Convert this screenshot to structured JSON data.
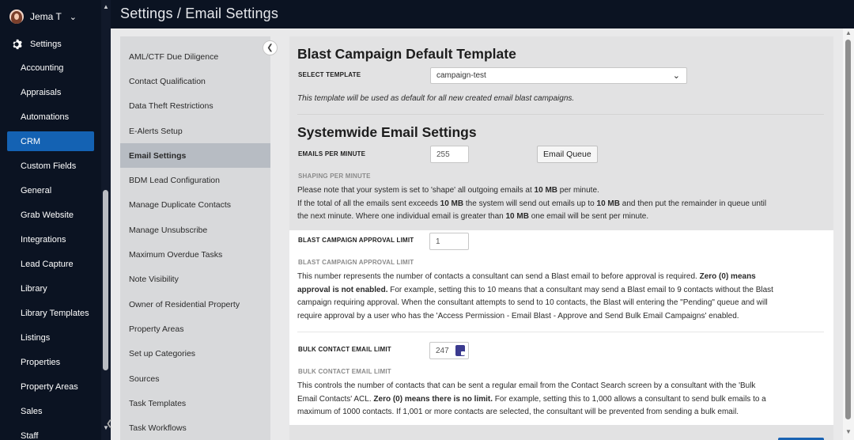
{
  "user": {
    "name": "Jema T"
  },
  "header": {
    "title": "Settings / Email Settings"
  },
  "nav": {
    "section": "Settings",
    "items": [
      "Accounting",
      "Appraisals",
      "Automations",
      "CRM",
      "Custom Fields",
      "General",
      "Grab Website",
      "Integrations",
      "Lead Capture",
      "Library",
      "Library Templates",
      "Listings",
      "Properties",
      "Property Areas",
      "Sales",
      "Staff"
    ],
    "active": "CRM"
  },
  "subnav": {
    "items": [
      "AML/CTF Due Diligence",
      "Contact Qualification",
      "Data Theft Restrictions",
      "E-Alerts Setup",
      "Email Settings",
      "BDM Lead Configuration",
      "Manage Duplicate Contacts",
      "Manage Unsubscribe",
      "Maximum Overdue Tasks",
      "Note Visibility",
      "Owner of Residential Property",
      "Property Areas",
      "Set up Categories",
      "Sources",
      "Task Templates",
      "Task Workflows"
    ],
    "active": "Email Settings"
  },
  "blast_template": {
    "title": "Blast Campaign Default Template",
    "select_label": "SELECT TEMPLATE",
    "selected": "campaign-test",
    "note": "This template will be used as default for all new created email blast campaigns."
  },
  "systemwide": {
    "title": "Systemwide Email Settings",
    "epm_label": "EMAILS PER MINUTE",
    "epm_value": "255",
    "queue_button": "Email Queue",
    "shaping_label": "SHAPING PER MINUTE",
    "shaping_text": {
      "p1a": "Please note that your system is set to 'shape' all outgoing emails at ",
      "p1b": "10 MB",
      "p1c": " per minute.",
      "p2a": "If the total of all the emails sent exceeds ",
      "p2b": "10 MB",
      "p2c": " the system will send out emails up to ",
      "p2d": "10 MB",
      "p2e": " and then put the remainder in queue until",
      "p3a": "the next minute. Where one individual email is greater than ",
      "p3b": "10 MB",
      "p3c": " one email will be sent per minute."
    }
  },
  "approval": {
    "label": "BLAST CAMPAIGN APPROVAL LIMIT",
    "value": "1",
    "sub_label": "BLAST CAMPAIGN APPROVAL LIMIT",
    "l1a": "This number represents the number of contacts a consultant can send a Blast email to before approval is required. ",
    "l1b": "Zero (0) means",
    "l2a": "approval is not enabled.",
    "l2b": " For example, setting this to 10 means that a consultant may send a Blast email to 9 contacts without the Blast",
    "l3": "campaign requiring approval. When the consultant attempts to send to 10 contacts, the Blast will entering the \"Pending\" queue and will",
    "l4": "require approval by a user who has the 'Access Permission - Email Blast - Approve and Send Bulk Email Campaigns' enabled."
  },
  "bulk": {
    "label": "BULK CONTACT EMAIL LIMIT",
    "value": "247",
    "sub_label": "BULK CONTACT EMAIL LIMIT",
    "l1": "This controls the number of contacts that can be sent a regular email from the Contact Search screen by a consultant with the 'Bulk",
    "l2a": "Email Contacts' ACL. ",
    "l2b": "Zero (0) means there is no limit.",
    "l2c": " For example, setting this to 1,000 allows a consultant to send bulk emails to a",
    "l3": "maximum of 1000 contacts. If 1,001 or more contacts are selected, the consultant will be prevented from sending a bulk email."
  }
}
